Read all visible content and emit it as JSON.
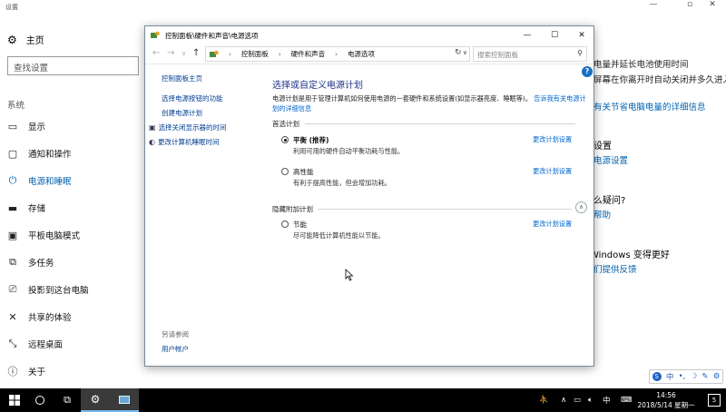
{
  "settings": {
    "window_title": "设置",
    "home_label": "主页",
    "search_placeholder": "查找设置",
    "section_label": "系统",
    "nav_items": [
      {
        "label": "显示",
        "icon": "monitor-icon"
      },
      {
        "label": "通知和操作",
        "icon": "message-icon"
      },
      {
        "label": "电源和睡眠",
        "icon": "power-icon",
        "active": true
      },
      {
        "label": "存储",
        "icon": "storage-icon"
      },
      {
        "label": "平板电脑模式",
        "icon": "tablet-icon"
      },
      {
        "label": "多任务",
        "icon": "multitask-icon"
      },
      {
        "label": "投影到这台电脑",
        "icon": "project-icon"
      },
      {
        "label": "共享的体验",
        "icon": "share-icon"
      },
      {
        "label": "远程桌面",
        "icon": "remote-icon"
      },
      {
        "label": "关于",
        "icon": "info-icon"
      }
    ],
    "right_panel": {
      "line1": "电量并延长电池使用时间",
      "line2": "屏幕在你离开时自动关闭并多久进入睡",
      "link1": "有关节省电脑电量的详细信息",
      "heading2": "设置",
      "link2": "电源设置",
      "heading3": "么疑问?",
      "link3": "帮助",
      "heading4": "Windows 变得更好",
      "link4": "们提供反馈"
    },
    "accent_color": "#0063b1"
  },
  "control_panel": {
    "title": "控制面板\\硬件和声音\\电源选项",
    "breadcrumb": [
      "控制面板",
      "硬件和声音",
      "电源选项"
    ],
    "search_placeholder": "搜索控制面板",
    "sidebar": {
      "home": "控制面板主页",
      "links": [
        "选择电源按钮的功能",
        "创建电源计划",
        "选择关闭显示器的时间",
        "更改计算机睡眠时间"
      ],
      "see_also_label": "另请参阅",
      "see_also_link": "用户帐户"
    },
    "heading": "选择或自定义电源计划",
    "description": "电源计划是用于管理计算机如何使用电源的一套硬件和系统设置(如显示器亮度、睡眠等)。",
    "description_link": "告诉我有关电源计划的详细信息",
    "preferred_label": "首选计划",
    "hidden_label": "隐藏附加计划",
    "plans": [
      {
        "name": "平衡 (推荐)",
        "desc": "利用可用的硬件自动平衡功耗与性能。",
        "selected": true,
        "change_label": "更改计划设置"
      },
      {
        "name": "高性能",
        "desc": "有利于提高性能，但会增加功耗。",
        "selected": false,
        "change_label": "更改计划设置"
      },
      {
        "name": "节能",
        "desc": "尽可能降低计算机性能以节能。",
        "selected": false,
        "change_label": "更改计划设置"
      }
    ]
  },
  "taskbar": {
    "time": "14:56",
    "date": "2018/5/14 星期一",
    "ime_indicator": "中",
    "notification_count": "5"
  },
  "ime_bar": {
    "mode": "中"
  }
}
